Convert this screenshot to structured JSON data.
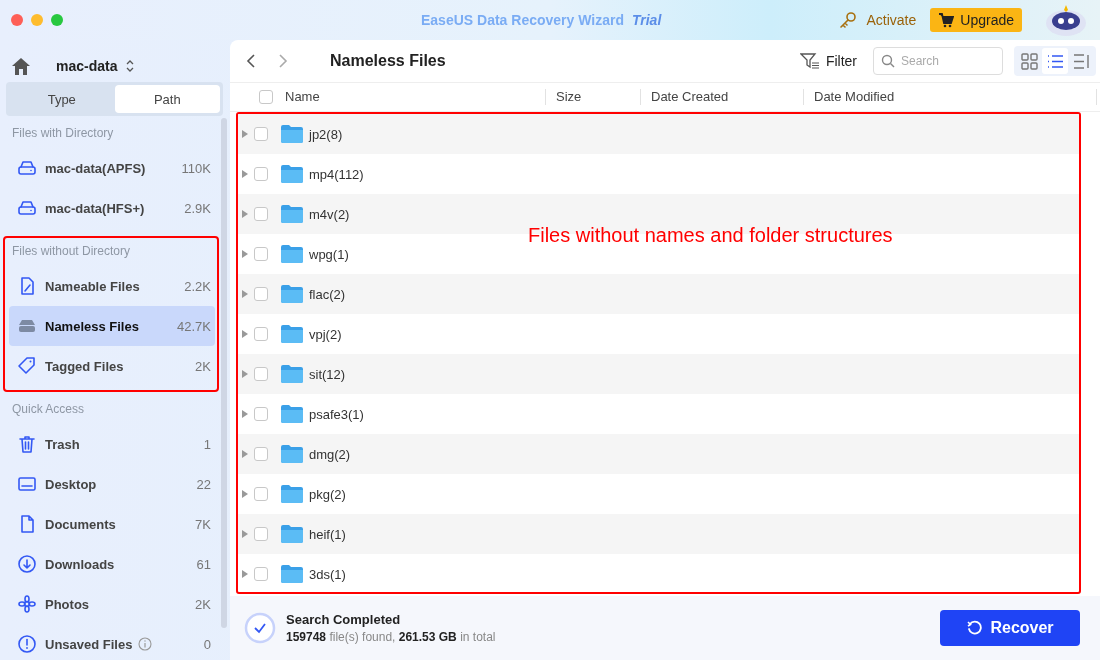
{
  "window": {
    "title": "EaseUS Data Recovery Wizard",
    "edition": "Trial",
    "activate": "Activate",
    "upgrade": "Upgrade"
  },
  "sidebar": {
    "drive": "mac-data",
    "tabs": [
      {
        "label": "Type",
        "selected": false
      },
      {
        "label": "Path",
        "selected": true
      }
    ],
    "sections": [
      {
        "title": "Files with Directory",
        "highlighted": false,
        "items": [
          {
            "label": "mac-data(APFS)",
            "count": "110K",
            "selected": false
          },
          {
            "label": "mac-data(HFS+)",
            "count": "2.9K",
            "selected": false
          }
        ]
      },
      {
        "title": "Files without Directory",
        "highlighted": true,
        "items": [
          {
            "label": "Nameable Files",
            "count": "2.2K",
            "selected": false
          },
          {
            "label": "Nameless Files",
            "count": "42.7K",
            "selected": true
          },
          {
            "label": "Tagged Files",
            "count": "2K",
            "selected": false
          }
        ]
      },
      {
        "title": "Quick Access",
        "highlighted": false,
        "items": [
          {
            "label": "Trash",
            "count": "1",
            "selected": false
          },
          {
            "label": "Desktop",
            "count": "22",
            "selected": false
          },
          {
            "label": "Documents",
            "count": "7K",
            "selected": false
          },
          {
            "label": "Downloads",
            "count": "61",
            "selected": false
          },
          {
            "label": "Photos",
            "count": "2K",
            "selected": false
          },
          {
            "label": "Unsaved Files",
            "count": "0",
            "selected": false
          }
        ]
      }
    ]
  },
  "toolbar": {
    "title": "Nameless Files",
    "filter": "Filter",
    "search": {
      "placeholder": "Search"
    },
    "views": [
      {
        "selected": false
      },
      {
        "selected": true
      },
      {
        "selected": false
      }
    ]
  },
  "table": {
    "columns": [
      "Name",
      "Size",
      "Date Created",
      "Date Modified"
    ],
    "all_checked": false,
    "highlighted": true,
    "rows": [
      {
        "name": "jp2(8)",
        "checked": false
      },
      {
        "name": "mp4(112)",
        "checked": false
      },
      {
        "name": "m4v(2)",
        "checked": false
      },
      {
        "name": "wpg(1)",
        "checked": false
      },
      {
        "name": "flac(2)",
        "checked": false
      },
      {
        "name": "vpj(2)",
        "checked": false
      },
      {
        "name": "sit(12)",
        "checked": false
      },
      {
        "name": "psafe3(1)",
        "checked": false
      },
      {
        "name": "dmg(2)",
        "checked": false
      },
      {
        "name": "pkg(2)",
        "checked": false
      },
      {
        "name": "heif(1)",
        "checked": false
      },
      {
        "name": "3ds(1)",
        "checked": false
      }
    ]
  },
  "annotation": "Files without names and folder structures",
  "status": {
    "title": "Search Completed",
    "detail": "**159748** file(s) found, **261.53 GB** in total",
    "button": "Recover"
  }
}
